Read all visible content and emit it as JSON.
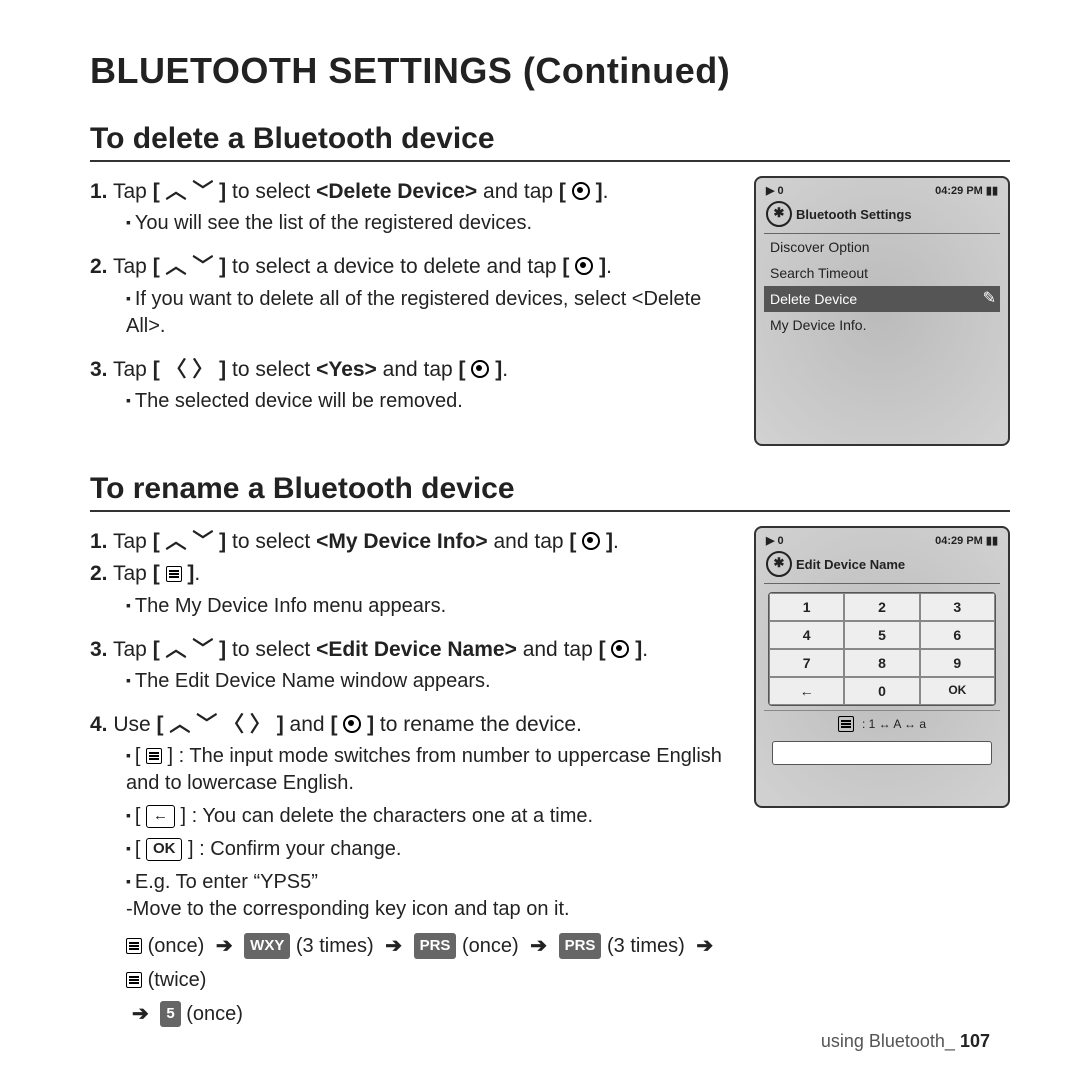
{
  "title": "BLUETOOTH SETTINGS (Continued)",
  "section1": {
    "heading": "To delete a Bluetooth device",
    "s1_pre": "Tap ",
    "s1_mid": " to select ",
    "s1_target": "<Delete Device>",
    "s1_post": " and tap ",
    "s1_sub": "You will see the list of the registered devices.",
    "s2_pre": "Tap ",
    "s2_mid": " to select a device to delete and tap ",
    "s2_sub": "If you want to delete all of the registered devices, select <Delete All>.",
    "s3_pre": "Tap ",
    "s3_mid": " to select ",
    "s3_target": "<Yes>",
    "s3_post": " and tap ",
    "s3_sub": "The selected device will be removed."
  },
  "device1": {
    "status_left": "▶ 0",
    "status_right": "04:29 PM",
    "title": "Bluetooth Settings",
    "items": [
      "Discover Option",
      "Search Timeout",
      "Delete Device",
      "My Device Info."
    ],
    "selected_index": 2
  },
  "section2": {
    "heading": "To rename a Bluetooth device",
    "s1_pre": "Tap ",
    "s1_mid": " to select ",
    "s1_target": "<My Device Info>",
    "s1_post": " and tap ",
    "s2_pre": "Tap ",
    "s2_sub": "The My Device Info menu appears.",
    "s3_pre": "Tap ",
    "s3_mid": " to select ",
    "s3_target": "<Edit Device Name>",
    "s3_post": " and tap ",
    "s3_sub": "The Edit Device Name window appears.",
    "s4_pre": "Use ",
    "s4_mid": " and ",
    "s4_post": " to rename the device.",
    "b1": ": The input mode switches from number to uppercase English and to lowercase English.",
    "b2": ": You can delete the characters one at a time.",
    "b3": ": Confirm your change.",
    "b4a": "E.g. To enter “YPS5”",
    "b4b": "-Move to the corresponding key icon and tap on it.",
    "seq_once": "(once)",
    "seq_3times": "(3 times)",
    "seq_twice": "(twice)",
    "key_wxy": "WXY",
    "key_prs": "PRS",
    "key_5": "5",
    "ok_label": "OK",
    "back_glyph": "←"
  },
  "device2": {
    "status_left": "▶ 0",
    "status_right": "04:29 PM",
    "title": "Edit Device Name",
    "keys": [
      [
        "1",
        "2",
        "3"
      ],
      [
        "4",
        "5",
        "6"
      ],
      [
        "7",
        "8",
        "9"
      ],
      [
        "←",
        "0",
        "OK"
      ]
    ],
    "mode": ": 1 ↔ A ↔ a"
  },
  "footer": {
    "label": "using Bluetooth_",
    "page": "107"
  }
}
